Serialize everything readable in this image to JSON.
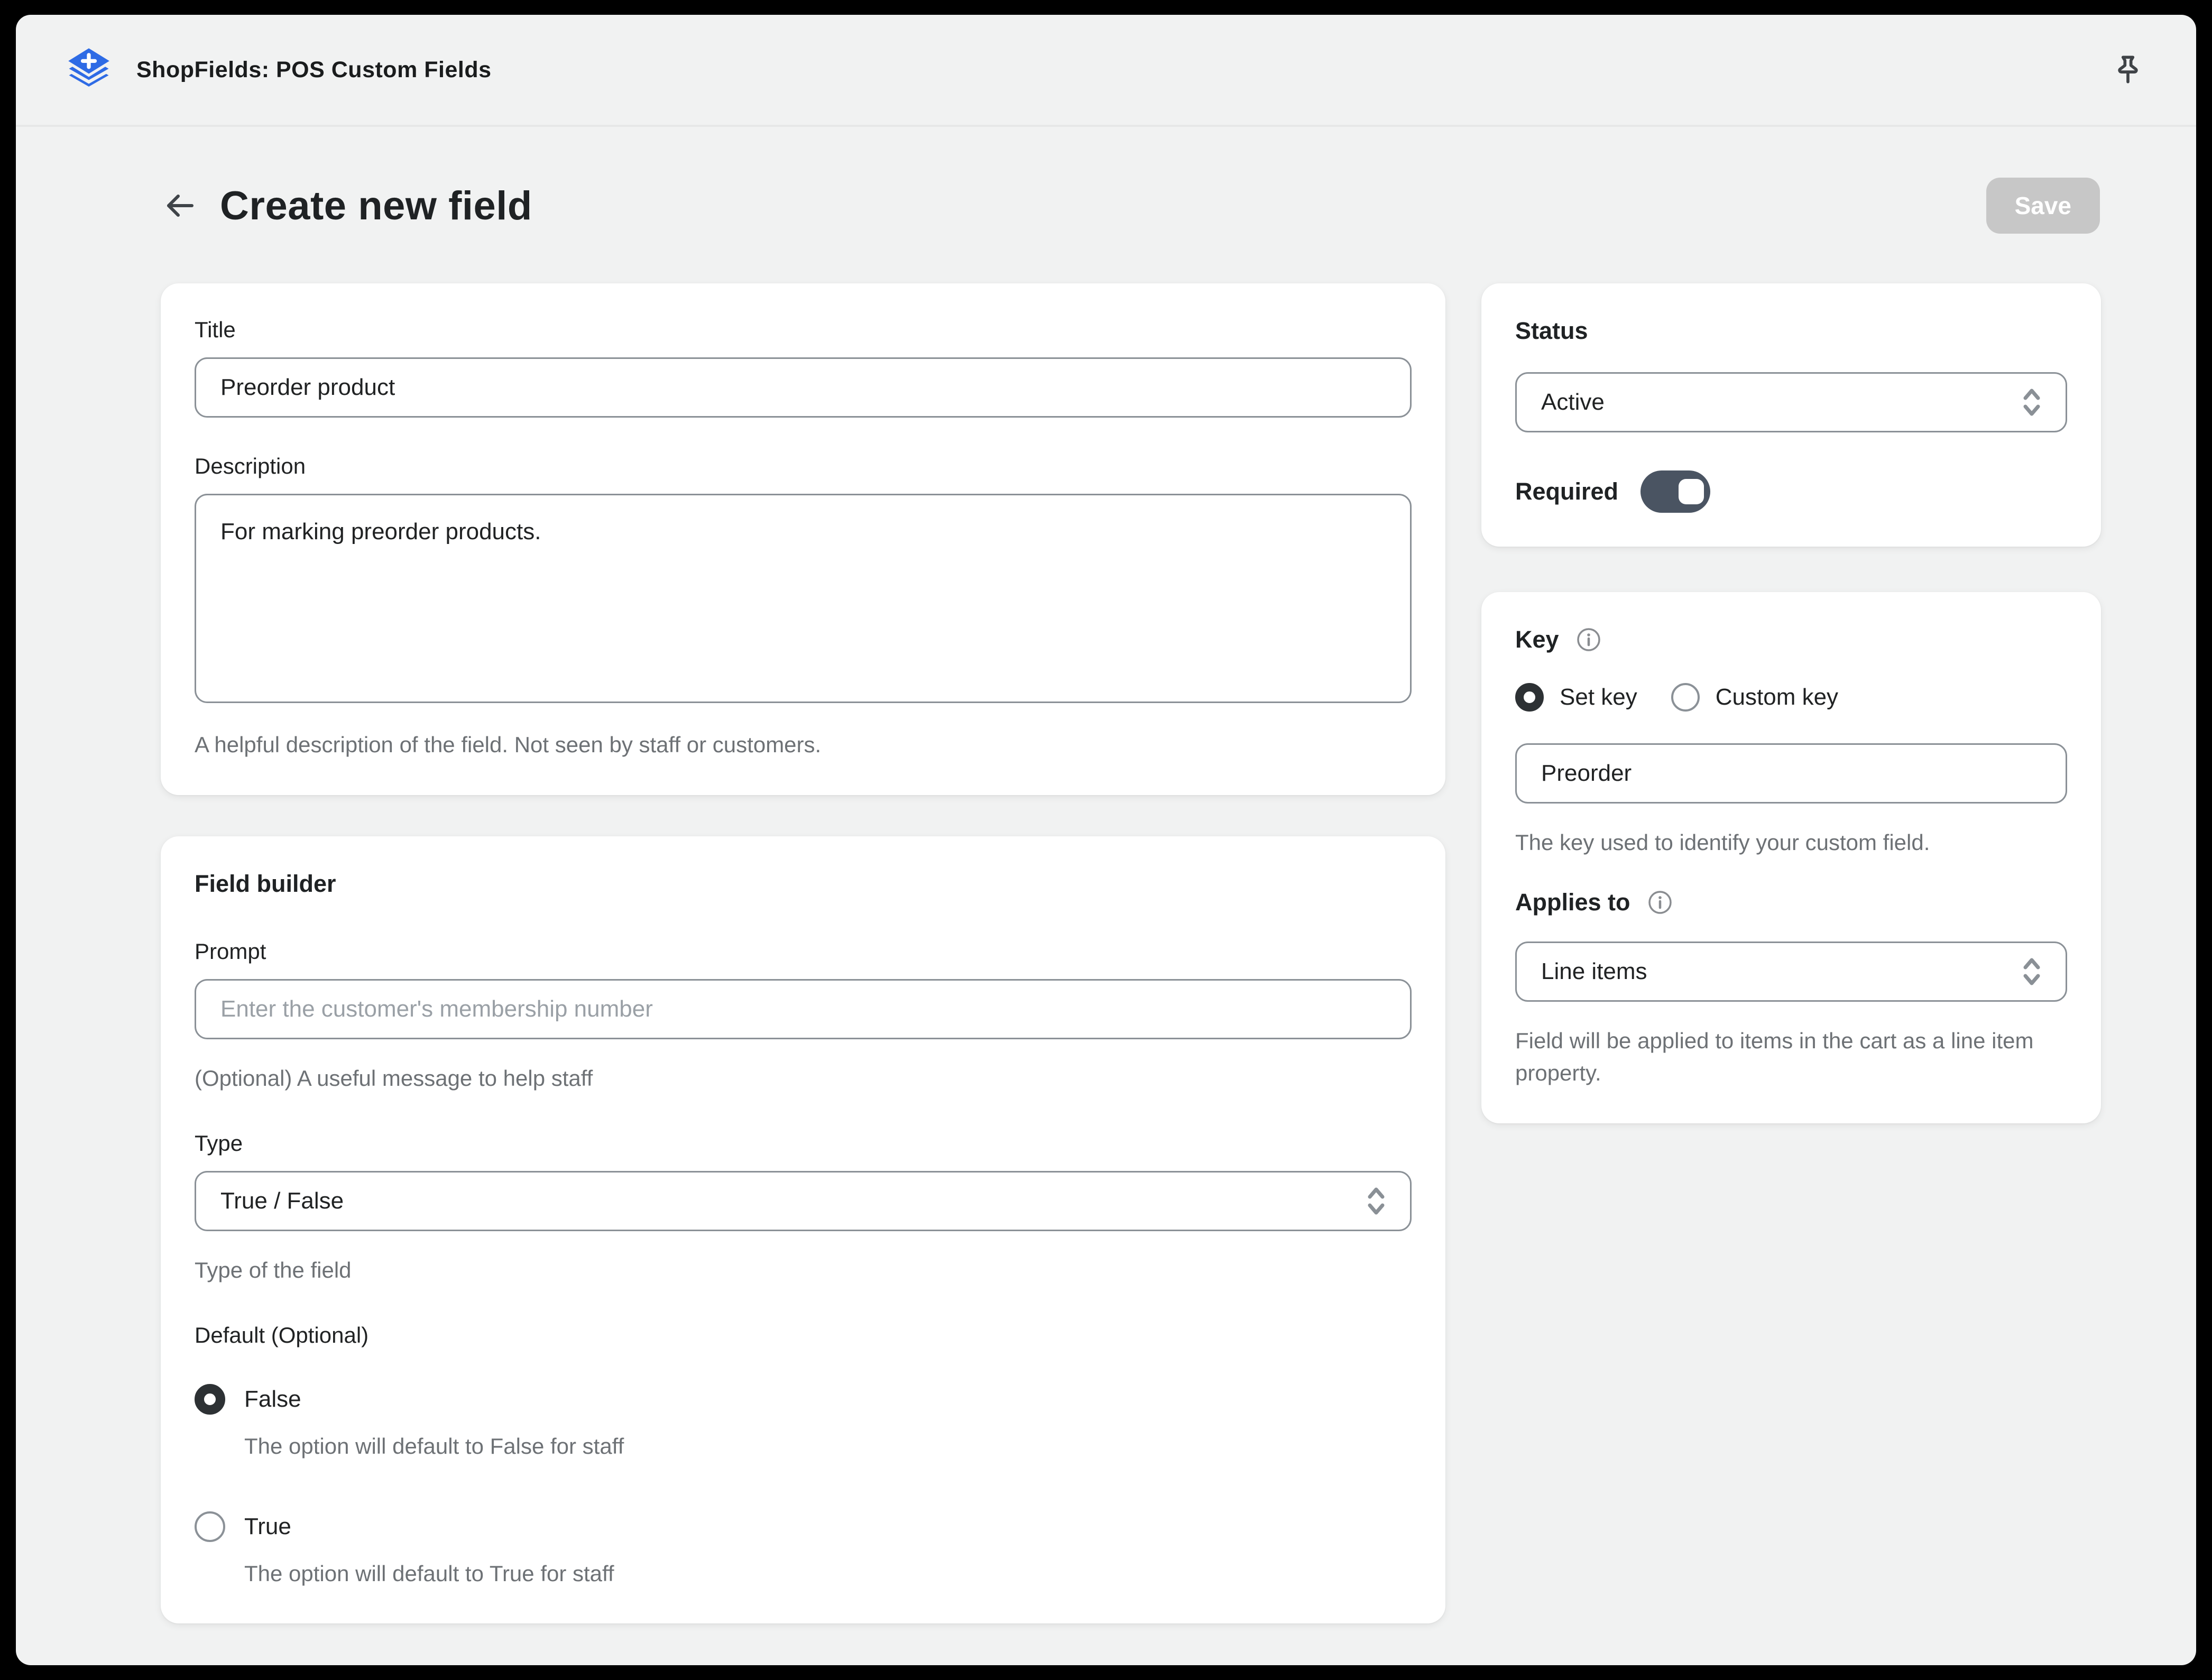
{
  "topbar": {
    "app_title": "ShopFields: POS Custom Fields",
    "app_icon": "layers-plus-icon",
    "pin_icon": "pushpin-icon"
  },
  "header": {
    "back_icon": "arrow-left-icon",
    "title": "Create new field",
    "save_label": "Save",
    "save_disabled": true
  },
  "details_card": {
    "title_label": "Title",
    "title_value": "Preorder product",
    "description_label": "Description",
    "description_value": "For marking preorder products.",
    "description_help": "A helpful description of the field. Not seen by staff or customers."
  },
  "field_builder_card": {
    "heading": "Field builder",
    "prompt_label": "Prompt",
    "prompt_placeholder": "Enter the customer's membership number",
    "prompt_help": "(Optional) A useful message to help staff",
    "type_label": "Type",
    "type_value": "True / False",
    "type_help": "Type of the field",
    "default_label": "Default (Optional)",
    "options": [
      {
        "label": "False",
        "help": "The option will default to False for staff",
        "selected": true
      },
      {
        "label": "True",
        "help": "The option will default to True for staff",
        "selected": false
      }
    ]
  },
  "status_card": {
    "heading": "Status",
    "status_value": "Active",
    "required_label": "Required",
    "required_on": true
  },
  "key_card": {
    "heading": "Key",
    "set_key_label": "Set key",
    "set_key_selected": true,
    "custom_key_label": "Custom key",
    "custom_key_selected": false,
    "key_value": "Preorder",
    "key_help": "The key used to identify your custom field.",
    "applies_heading": "Applies to",
    "applies_value": "Line items",
    "applies_help": "Field will be applied to items in the cart as a line item property."
  },
  "colors": {
    "app_icon_blue": "#2e6be5",
    "toggle_on": "#4a5462",
    "save_disabled_bg": "#c7c7c7",
    "input_border": "#8b9197",
    "helper_text": "#6d7175",
    "window_bg": "#f1f2f2"
  }
}
